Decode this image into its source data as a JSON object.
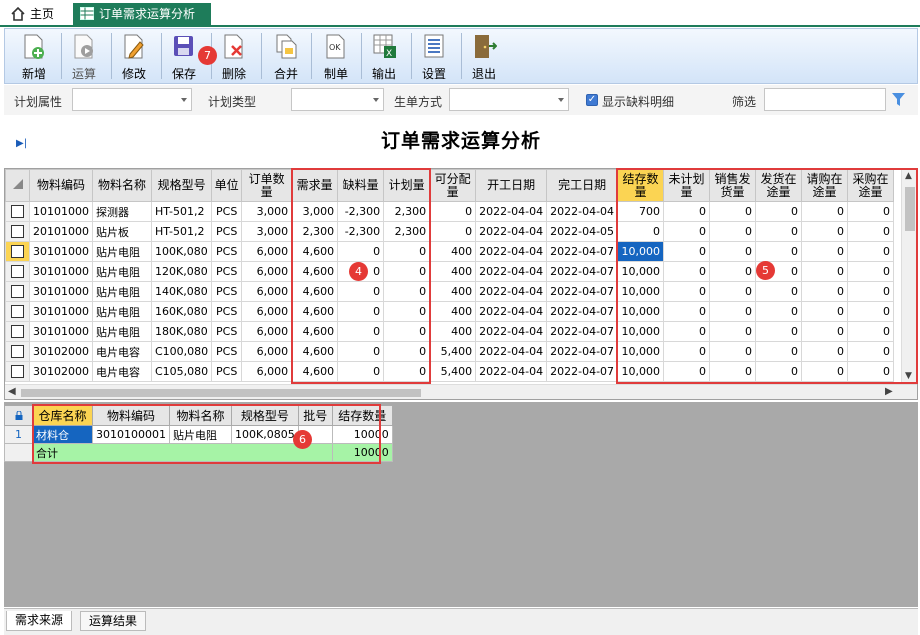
{
  "tabs": {
    "home": "主页",
    "active": "订单需求运算分析"
  },
  "toolbar": [
    {
      "name": "add",
      "label": "新增",
      "icon": "add-doc-icon"
    },
    {
      "name": "compute",
      "label": "运算",
      "icon": "play-icon"
    },
    {
      "name": "edit",
      "label": "修改",
      "icon": "edit-icon"
    },
    {
      "name": "save",
      "label": "保存",
      "icon": "save-icon"
    },
    {
      "name": "delete",
      "label": "删除",
      "icon": "delete-icon"
    },
    {
      "name": "merge",
      "label": "合并",
      "icon": "merge-icon"
    },
    {
      "name": "make",
      "label": "制单",
      "icon": "ok-doc-icon"
    },
    {
      "name": "export",
      "label": "输出",
      "icon": "excel-icon"
    },
    {
      "name": "settings",
      "label": "设置",
      "icon": "settings-icon"
    },
    {
      "name": "exit",
      "label": "退出",
      "icon": "exit-door-icon"
    }
  ],
  "filter": {
    "plan_attr": "计划属性",
    "plan_type": "计划类型",
    "order_mode": "生单方式",
    "show_shortage": "显示缺料明细",
    "search": "筛选"
  },
  "page_title": "订单需求运算分析",
  "grid": {
    "headers": [
      "物料编码",
      "物料名称",
      "规格型号",
      "单位",
      "订单数量",
      "需求量",
      "缺料量",
      "计划量",
      "可分配量",
      "开工日期",
      "完工日期",
      "结存数量",
      "未计划量",
      "销售发货量",
      "发货在途量",
      "请购在途量",
      "采购在途量"
    ],
    "rows": [
      [
        "10101000",
        "探测器",
        "HT-501,2",
        "PCS",
        "3,000",
        "3,000",
        "-2,300",
        "2,300",
        "0",
        "2022-04-04",
        "2022-04-04",
        "700",
        "0",
        "0",
        "0",
        "0",
        "0"
      ],
      [
        "20101000",
        "贴片板",
        "HT-501,2",
        "PCS",
        "3,000",
        "2,300",
        "-2,300",
        "2,300",
        "0",
        "2022-04-04",
        "2022-04-05",
        "0",
        "0",
        "0",
        "0",
        "0",
        "0"
      ],
      [
        "30101000",
        "贴片电阻",
        "100K,080",
        "PCS",
        "6,000",
        "4,600",
        "0",
        "0",
        "400",
        "2022-04-04",
        "2022-04-07",
        "10,000",
        "0",
        "0",
        "0",
        "0",
        "0"
      ],
      [
        "30101000",
        "贴片电阻",
        "120K,080",
        "PCS",
        "6,000",
        "4,600",
        "0",
        "0",
        "400",
        "2022-04-04",
        "2022-04-07",
        "10,000",
        "0",
        "0",
        "0",
        "0",
        "0"
      ],
      [
        "30101000",
        "贴片电阻",
        "140K,080",
        "PCS",
        "6,000",
        "4,600",
        "0",
        "0",
        "400",
        "2022-04-04",
        "2022-04-07",
        "10,000",
        "0",
        "0",
        "0",
        "0",
        "0"
      ],
      [
        "30101000",
        "贴片电阻",
        "160K,080",
        "PCS",
        "6,000",
        "4,600",
        "0",
        "0",
        "400",
        "2022-04-04",
        "2022-04-07",
        "10,000",
        "0",
        "0",
        "0",
        "0",
        "0"
      ],
      [
        "30101000",
        "贴片电阻",
        "180K,080",
        "PCS",
        "6,000",
        "4,600",
        "0",
        "0",
        "400",
        "2022-04-04",
        "2022-04-07",
        "10,000",
        "0",
        "0",
        "0",
        "0",
        "0"
      ],
      [
        "30102000",
        "电片电容",
        "C100,080",
        "PCS",
        "6,000",
        "4,600",
        "0",
        "0",
        "5,400",
        "2022-04-04",
        "2022-04-07",
        "10,000",
        "0",
        "0",
        "0",
        "0",
        "0"
      ],
      [
        "30102000",
        "电片电容",
        "C105,080",
        "PCS",
        "6,000",
        "4,600",
        "0",
        "0",
        "5,400",
        "2022-04-04",
        "2022-04-07",
        "10,000",
        "0",
        "0",
        "0",
        "0",
        "0"
      ]
    ]
  },
  "badges": [
    "7",
    "4",
    "5",
    "6"
  ],
  "stock": {
    "headers": [
      "仓库名称",
      "物料编码",
      "物料名称",
      "规格型号",
      "批号",
      "结存数量"
    ],
    "rows": [
      [
        "1",
        "材料仓",
        "3010100001",
        "贴片电阻",
        "100K,0805",
        "",
        "10000"
      ]
    ],
    "total_label": "合计",
    "total_value": "10000"
  },
  "bottom_tabs": [
    "需求来源",
    "运算结果"
  ]
}
